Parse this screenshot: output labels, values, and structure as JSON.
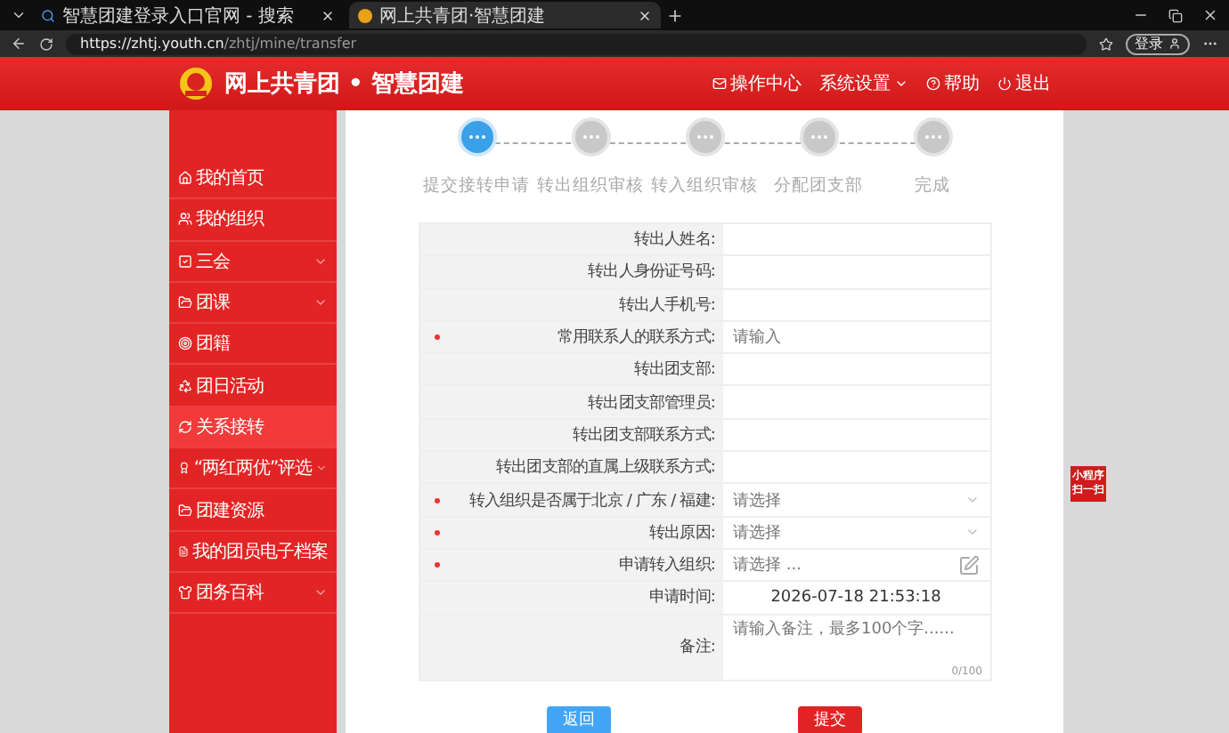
{
  "browser": {
    "tabs": [
      {
        "label": "智慧团建登录入口官网 - 搜索",
        "selected": false
      },
      {
        "label": "网上共青团·智慧团建",
        "selected": true
      }
    ],
    "url_host": "https://zhtj.youth.cn",
    "url_path": "/zhtj/mine/transfer",
    "login": "登录"
  },
  "header": {
    "title": "网上共青团 • 智慧团建",
    "nav": [
      {
        "label": "操作中心",
        "dropdown": false
      },
      {
        "label": "系统设置",
        "dropdown": true
      },
      {
        "label": "帮助",
        "dropdown": false
      },
      {
        "label": "退出",
        "dropdown": false
      }
    ]
  },
  "sidebar": {
    "items": [
      {
        "label": "我的首页",
        "selected": false,
        "expandable": false
      },
      {
        "label": "我的组织",
        "selected": false,
        "expandable": false
      },
      {
        "label": "三会",
        "selected": false,
        "expandable": true
      },
      {
        "label": "团课",
        "selected": false,
        "expandable": true
      },
      {
        "label": "团籍",
        "selected": false,
        "expandable": false
      },
      {
        "label": "团日活动",
        "selected": false,
        "expandable": false
      },
      {
        "label": "关系接转",
        "selected": true,
        "expandable": false
      },
      {
        "label": "“两红两优”评选",
        "selected": false,
        "expandable": true
      },
      {
        "label": "团建资源",
        "selected": false,
        "expandable": false
      },
      {
        "label": "我的团员电子档案",
        "selected": false,
        "expandable": false
      },
      {
        "label": "团务百科",
        "selected": false,
        "expandable": true
      }
    ]
  },
  "steps": [
    {
      "label": "提交接转申请",
      "active": true
    },
    {
      "label": "转出组织审核",
      "active": false
    },
    {
      "label": "转入组织审核",
      "active": false
    },
    {
      "label": "分配团支部",
      "active": false
    },
    {
      "label": "完成",
      "active": false
    }
  ],
  "form": [
    {
      "label": "转出人姓名:",
      "kind": "text",
      "required": false
    },
    {
      "label": "转出人身份证号码:",
      "kind": "text",
      "required": false
    },
    {
      "label": "转出人手机号:",
      "kind": "text",
      "required": false
    },
    {
      "label": "常用联系人的联系方式:",
      "kind": "input",
      "required": true,
      "placeholder": "请输入"
    },
    {
      "label": "转出团支部:",
      "kind": "text",
      "required": false
    },
    {
      "label": "转出团支部管理员:",
      "kind": "text",
      "required": false
    },
    {
      "label": "转出团支部联系方式:",
      "kind": "text",
      "required": false
    },
    {
      "label": "转出团支部的直属上级联系方式:",
      "kind": "text",
      "required": false
    },
    {
      "label": "转入组织是否属于北京 / 广东 / 福建:",
      "kind": "select",
      "required": true,
      "placeholder": "请选择"
    },
    {
      "label": "转出原因:",
      "kind": "select",
      "required": true,
      "placeholder": "请选择"
    },
    {
      "label": "申请转入组织:",
      "kind": "picker",
      "required": true,
      "placeholder": "请选择 ..."
    },
    {
      "label": "申请时间:",
      "kind": "time",
      "required": false,
      "value": "2026-07-18 21:53:18"
    },
    {
      "label": "备注:",
      "kind": "textarea",
      "required": false,
      "placeholder": "请输入备注，最多100个字......",
      "counter": "0/100"
    }
  ],
  "buttons": [
    {
      "label": "返回",
      "kind": "back"
    },
    {
      "label": "提交",
      "kind": "submit"
    }
  ],
  "side_badge": [
    "小程序",
    "扫一扫"
  ]
}
